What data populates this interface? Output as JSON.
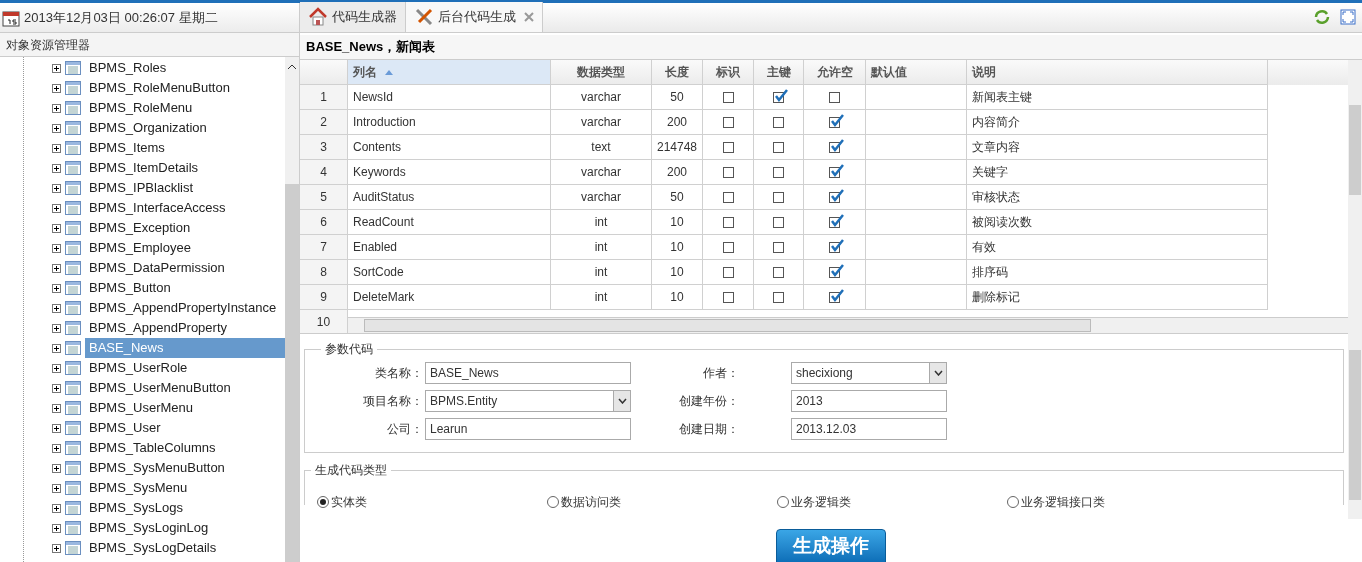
{
  "header": {
    "datetime": "2013年12月03日 00:26:07 星期二"
  },
  "explorer": {
    "title": "对象资源管理器",
    "items": [
      {
        "label": "BPMS_Roles",
        "selected": false
      },
      {
        "label": "BPMS_RoleMenuButton",
        "selected": false
      },
      {
        "label": "BPMS_RoleMenu",
        "selected": false
      },
      {
        "label": "BPMS_Organization",
        "selected": false
      },
      {
        "label": "BPMS_Items",
        "selected": false
      },
      {
        "label": "BPMS_ItemDetails",
        "selected": false
      },
      {
        "label": "BPMS_IPBlacklist",
        "selected": false
      },
      {
        "label": "BPMS_InterfaceAccess",
        "selected": false
      },
      {
        "label": "BPMS_Exception",
        "selected": false
      },
      {
        "label": "BPMS_Employee",
        "selected": false
      },
      {
        "label": "BPMS_DataPermission",
        "selected": false
      },
      {
        "label": "BPMS_Button",
        "selected": false
      },
      {
        "label": "BPMS_AppendPropertyInstance",
        "selected": false
      },
      {
        "label": "BPMS_AppendProperty",
        "selected": false
      },
      {
        "label": "BASE_News",
        "selected": true
      },
      {
        "label": "BPMS_UserRole",
        "selected": false
      },
      {
        "label": "BPMS_UserMenuButton",
        "selected": false
      },
      {
        "label": "BPMS_UserMenu",
        "selected": false
      },
      {
        "label": "BPMS_User",
        "selected": false
      },
      {
        "label": "BPMS_TableColumns",
        "selected": false
      },
      {
        "label": "BPMS_SysMenuButton",
        "selected": false
      },
      {
        "label": "BPMS_SysMenu",
        "selected": false
      },
      {
        "label": "BPMS_SysLogs",
        "selected": false
      },
      {
        "label": "BPMS_SysLoginLog",
        "selected": false
      },
      {
        "label": "BPMS_SysLogDetails",
        "selected": false
      }
    ]
  },
  "tabs": [
    {
      "label": "代码生成器",
      "selected": false,
      "closable": false
    },
    {
      "label": "后台代码生成",
      "selected": true,
      "closable": true
    }
  ],
  "table_title": "BASE_News，新闻表",
  "table": {
    "columns": [
      "列名",
      "数据类型",
      "长度",
      "标识",
      "主键",
      "允许空",
      "默认值",
      "说明"
    ],
    "rows": [
      {
        "number": "1",
        "name": "NewsId",
        "type": "varchar",
        "length": "50",
        "identity": false,
        "primary_key": true,
        "nullable": false,
        "description": "新闻表主键"
      },
      {
        "number": "2",
        "name": "Introduction",
        "type": "varchar",
        "length": "200",
        "identity": false,
        "primary_key": false,
        "nullable": true,
        "description": "内容简介"
      },
      {
        "number": "3",
        "name": "Contents",
        "type": "text",
        "length": "214748",
        "identity": false,
        "primary_key": false,
        "nullable": true,
        "description": "文章内容"
      },
      {
        "number": "4",
        "name": "Keywords",
        "type": "varchar",
        "length": "200",
        "identity": false,
        "primary_key": false,
        "nullable": true,
        "description": "关键字"
      },
      {
        "number": "5",
        "name": "AuditStatus",
        "type": "varchar",
        "length": "50",
        "identity": false,
        "primary_key": false,
        "nullable": true,
        "description": "审核状态"
      },
      {
        "number": "6",
        "name": "ReadCount",
        "type": "int",
        "length": "10",
        "identity": false,
        "primary_key": false,
        "nullable": true,
        "description": "被阅读次数"
      },
      {
        "number": "7",
        "name": "Enabled",
        "type": "int",
        "length": "10",
        "identity": false,
        "primary_key": false,
        "nullable": true,
        "description": "有效"
      },
      {
        "number": "8",
        "name": "SortCode",
        "type": "int",
        "length": "10",
        "identity": false,
        "primary_key": false,
        "nullable": true,
        "description": "排序码"
      },
      {
        "number": "9",
        "name": "DeleteMark",
        "type": "int",
        "length": "10",
        "identity": false,
        "primary_key": false,
        "nullable": true,
        "description": "删除标记"
      },
      {
        "number": "10"
      }
    ]
  },
  "params": {
    "legend": "参数代码",
    "fields": [
      {
        "label": "类名称：",
        "kind": "text",
        "value": "BASE_News"
      },
      {
        "label": "作者：",
        "kind": "select",
        "value": "shecixiong"
      },
      {
        "label": "项目名称：",
        "kind": "select",
        "value": "BPMS.Entity"
      },
      {
        "label": "创建年份：",
        "kind": "text",
        "value": "2013"
      },
      {
        "label": "公司：",
        "kind": "text",
        "value": "Learun"
      },
      {
        "label": "创建日期：",
        "kind": "text",
        "value": "2013.12.03"
      }
    ]
  },
  "code_type": {
    "legend": "生成代码类型",
    "options": [
      {
        "label": "实体类",
        "selected": true
      },
      {
        "label": "数据访问类",
        "selected": false
      },
      {
        "label": "业务逻辑类",
        "selected": false
      },
      {
        "label": "业务逻辑接口类",
        "selected": false
      }
    ]
  },
  "generate_button": "生成操作"
}
